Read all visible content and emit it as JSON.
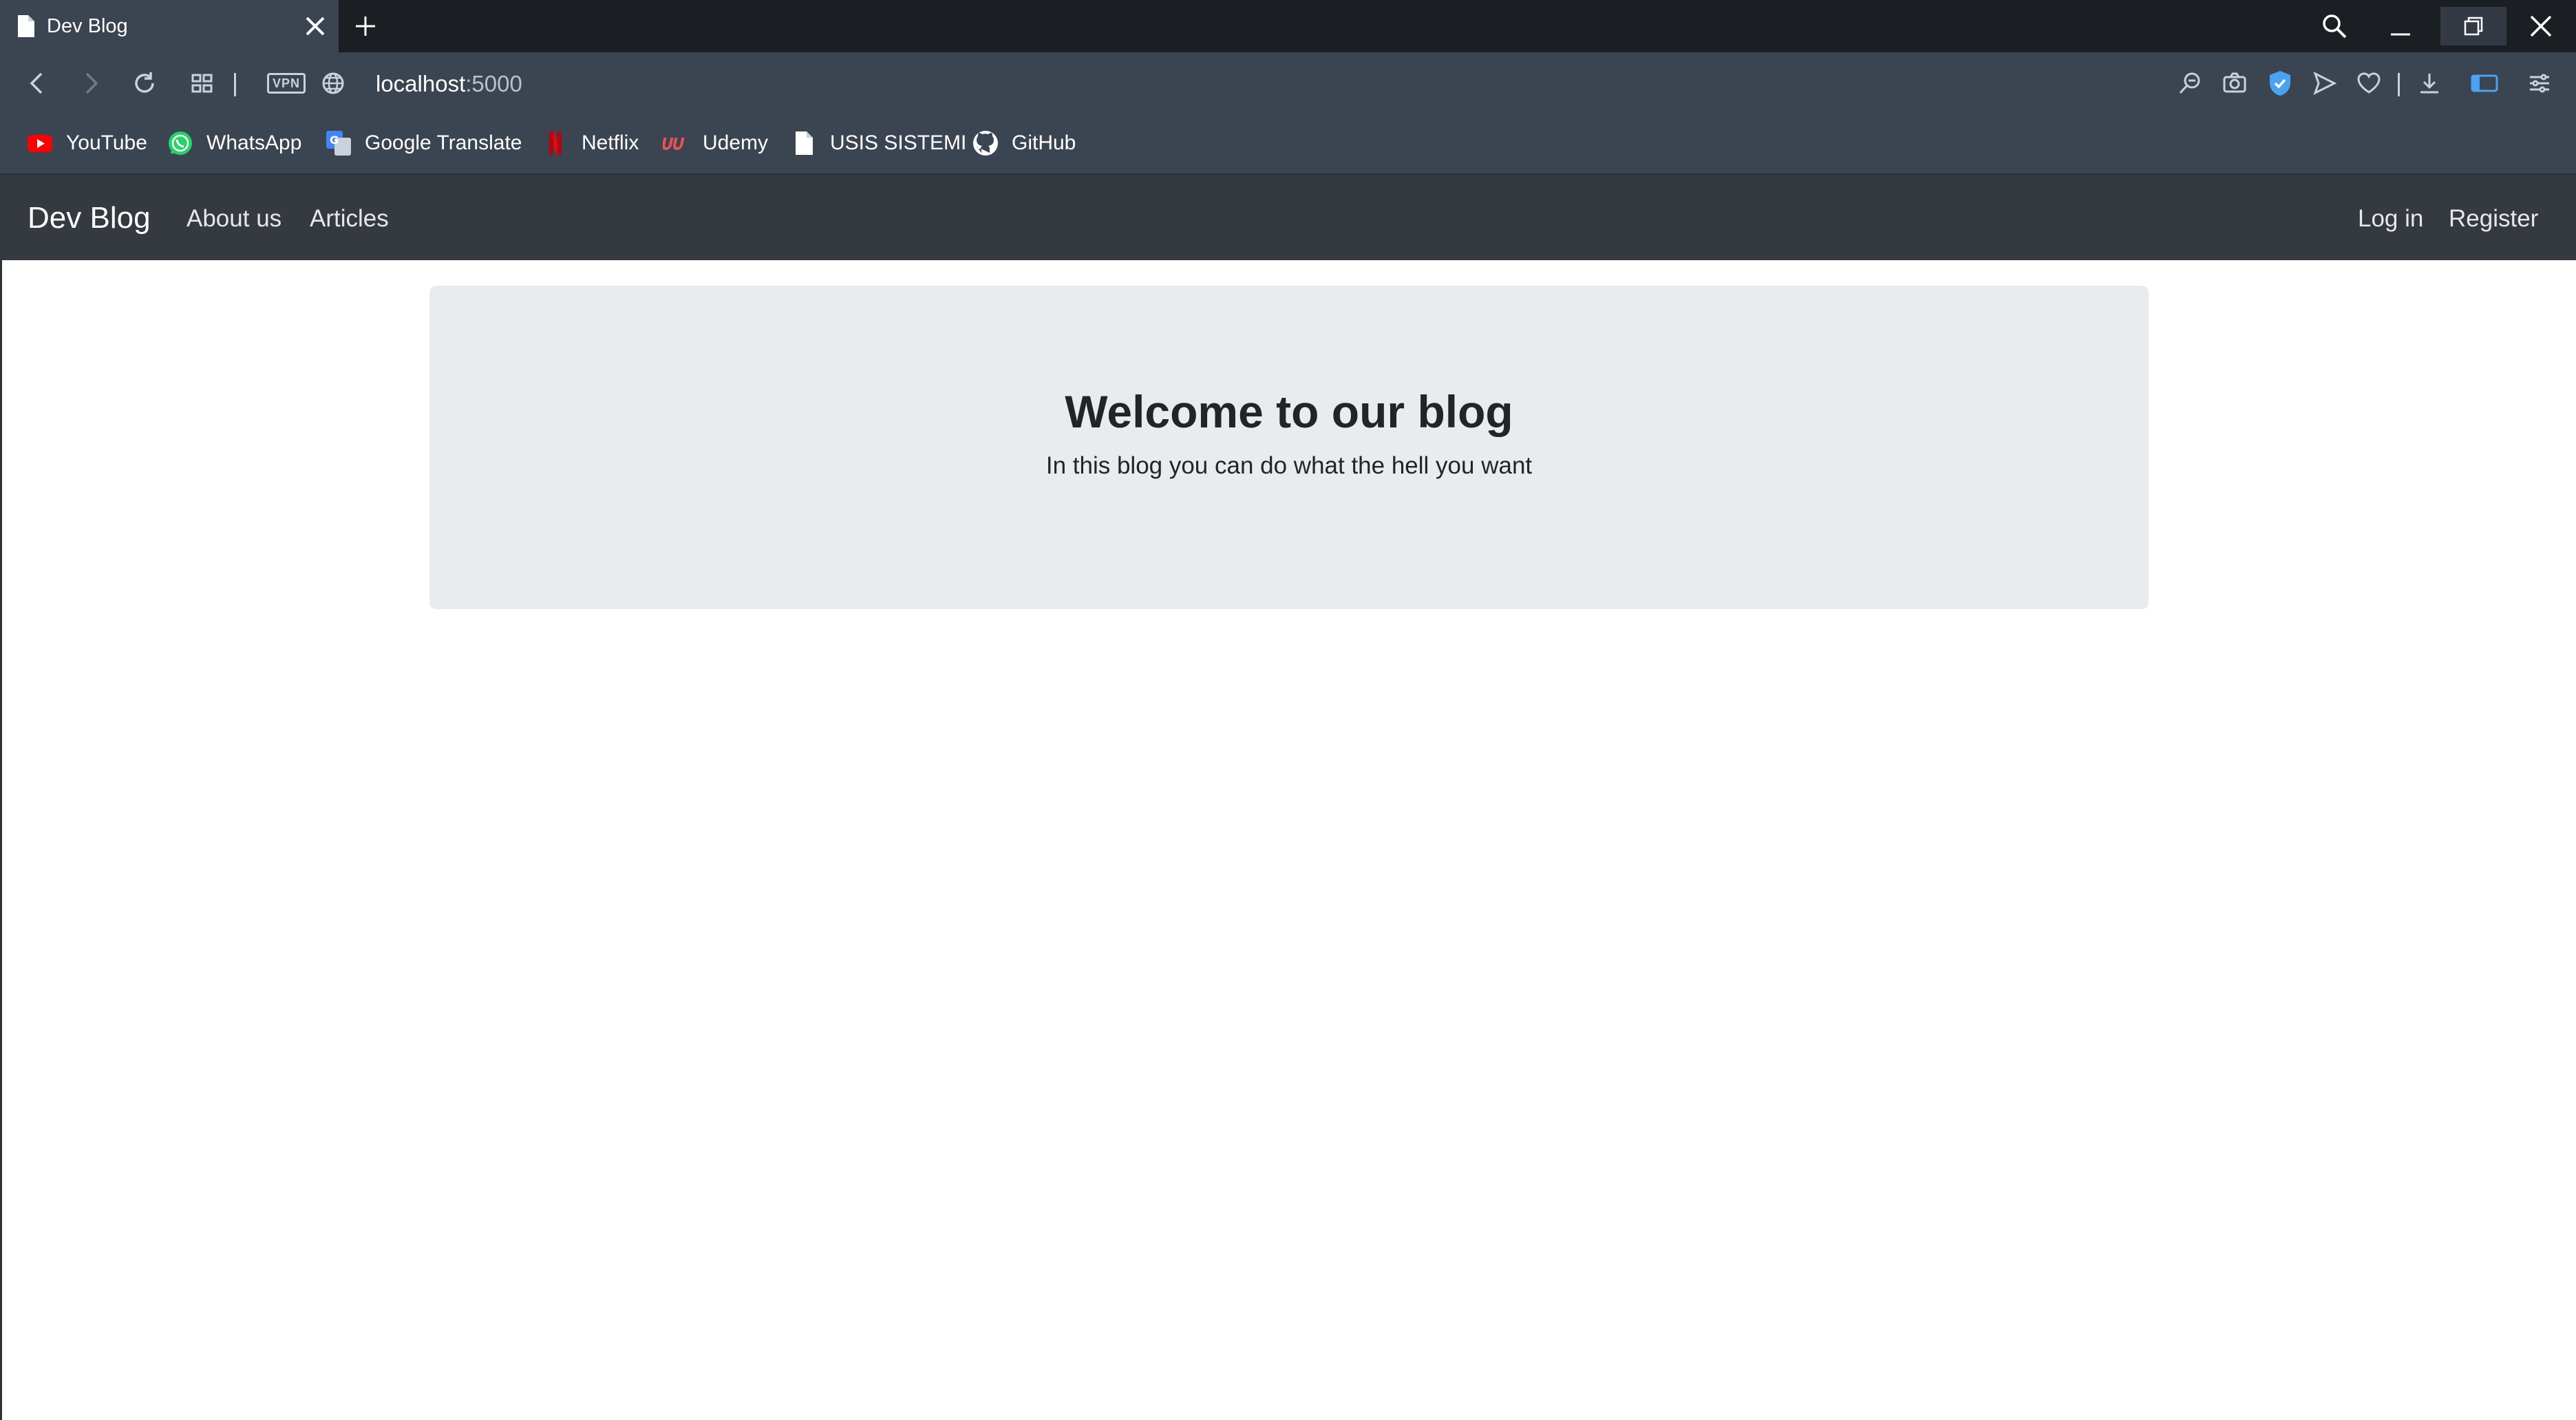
{
  "browser": {
    "tab_title": "Dev Blog",
    "url_host": "localhost",
    "url_port": ":5000",
    "vpn_label": "VPN",
    "accent_color": "#4aa3f0"
  },
  "bookmarks": [
    {
      "label": "YouTube",
      "icon": "youtube-icon"
    },
    {
      "label": "WhatsApp",
      "icon": "whatsapp-icon"
    },
    {
      "label": "Google Translate",
      "icon": "google-translate-icon"
    },
    {
      "label": "Netflix",
      "icon": "netflix-icon"
    },
    {
      "label": "Udemy",
      "icon": "udemy-icon"
    },
    {
      "label": "USIS SISTEMI",
      "icon": "document-icon"
    },
    {
      "label": "GitHub",
      "icon": "github-icon"
    }
  ],
  "navbar": {
    "brand": "Dev Blog",
    "links": [
      "About us",
      "Articles"
    ],
    "auth_links": [
      "Log in",
      "Register"
    ],
    "background": "#343a40"
  },
  "jumbotron": {
    "title": "Welcome to our blog",
    "subtitle": "In this blog you can do what the hell you want",
    "background": "#e9ecef"
  }
}
